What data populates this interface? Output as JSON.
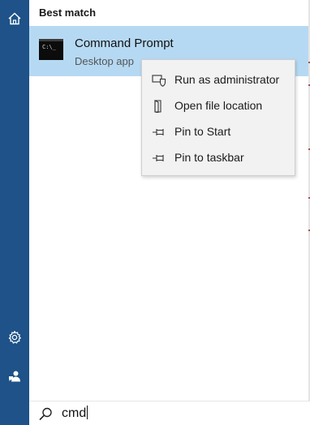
{
  "rail": {
    "home_icon": "home-icon",
    "settings_icon": "gear-icon",
    "feedback_icon": "feedback-icon"
  },
  "results": {
    "section_header": "Best match",
    "best_match": {
      "title": "Command Prompt",
      "subtitle": "Desktop app",
      "icon_glyph": "C:\\_",
      "icon": "command-prompt-icon"
    }
  },
  "context_menu": {
    "items": [
      {
        "label": "Run as administrator",
        "icon": "shield-run-icon"
      },
      {
        "label": "Open file location",
        "icon": "file-location-icon"
      },
      {
        "label": "Pin to Start",
        "icon": "pin-icon"
      },
      {
        "label": "Pin to taskbar",
        "icon": "pin-icon"
      }
    ]
  },
  "search": {
    "value": "cmd",
    "icon": "search-icon"
  },
  "colors": {
    "rail": "#1e5288",
    "selection": "#b6d9f3",
    "menu": "#f2f2f2"
  }
}
